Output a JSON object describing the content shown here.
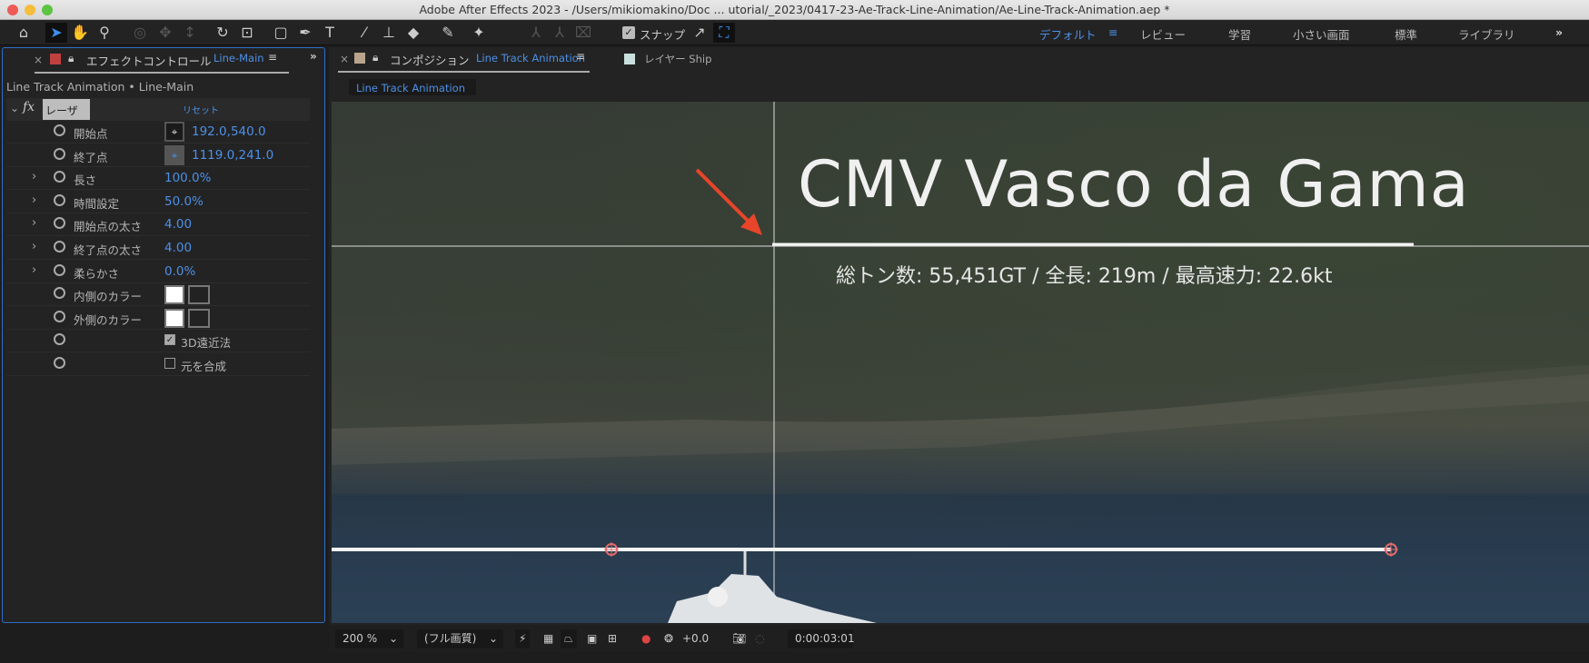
{
  "window": {
    "title": "Adobe After Effects 2023 - /Users/mikiomakino/Doc ... utorial/_2023/0417-23-Ae-Track-Line-Animation/Ae-Line-Track-Animation.aep *"
  },
  "toolbar": {
    "snap_label": "スナップ",
    "snap_checked": true
  },
  "workspaces": [
    {
      "label": "デフォルト",
      "active": true
    },
    {
      "label": "レビュー"
    },
    {
      "label": "学習"
    },
    {
      "label": "小さい画面"
    },
    {
      "label": "標準"
    },
    {
      "label": "ライブラリ"
    }
  ],
  "effect_panel": {
    "tab_label": "エフェクトコントロール",
    "tab_layer": "Line-Main",
    "breadcrumb": "Line Track Animation • Line-Main",
    "effect_name": "レーザー",
    "reset_label": "リセット",
    "params": [
      {
        "label": "開始点",
        "value": "192.0,540.0"
      },
      {
        "label": "終了点",
        "value": "1119.0,241.0"
      },
      {
        "label": "長さ",
        "value": "100.0%"
      },
      {
        "label": "時間設定",
        "value": "50.0%"
      },
      {
        "label": "開始点の太さ",
        "value": "4.00"
      },
      {
        "label": "終了点の太さ",
        "value": "4.00"
      },
      {
        "label": "柔らかさ",
        "value": "0.0%"
      },
      {
        "label": "内側のカラー",
        "color": "#ffffff"
      },
      {
        "label": "外側のカラー",
        "color": "#ffffff"
      },
      {
        "label": "",
        "checkbox": "3D遠近法",
        "checked": true
      },
      {
        "label": "",
        "checkbox": "元を合成",
        "checked": false
      }
    ]
  },
  "comp_panel": {
    "tab_label": "コンポジション",
    "tab_comp": "Line Track Animation",
    "layer_tab": "レイヤー Ship",
    "subtab": "Line Track Animation",
    "overlay_title": "CMV Vasco da Gama",
    "overlay_subtitle": "総トン数: 55,451GT / 全長: 219m / 最高速力: 22.6kt"
  },
  "viewer_bar": {
    "zoom": "200 %",
    "quality": "(フル画質)",
    "exposure": "+0.0",
    "timecode": "0:00:03:01"
  }
}
